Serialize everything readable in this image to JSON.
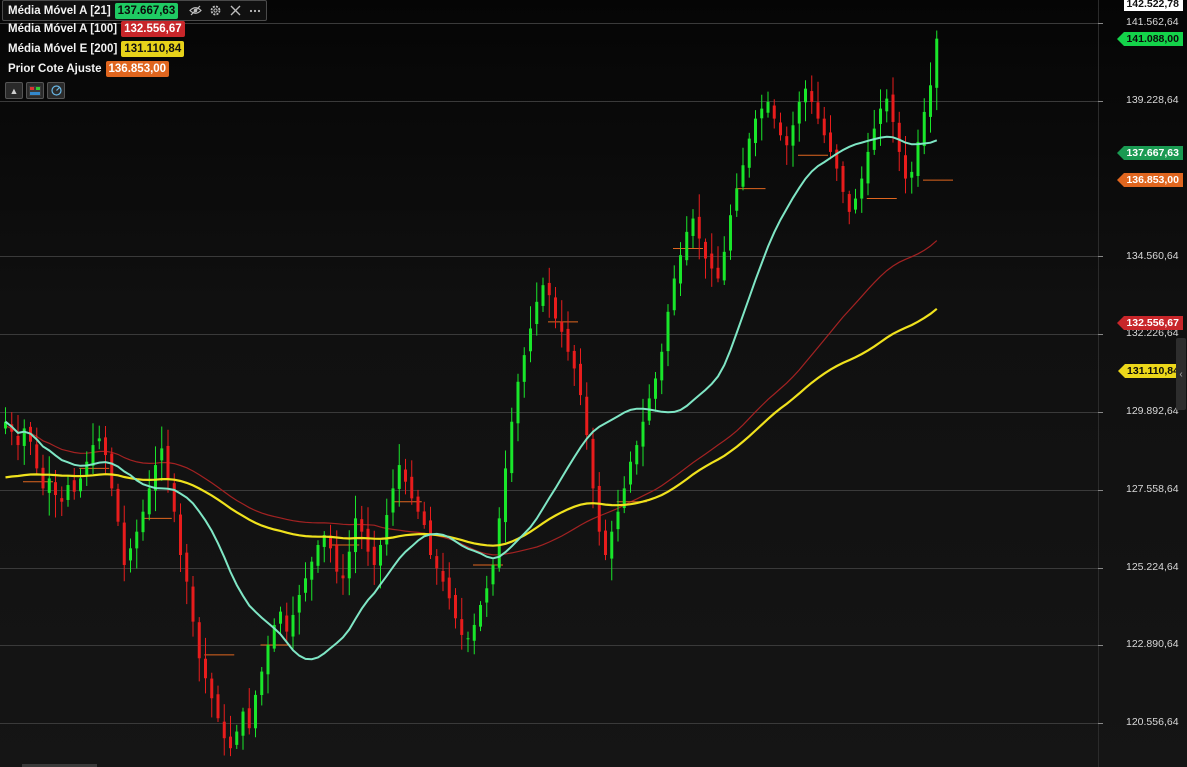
{
  "legend": [
    {
      "label": "Média Móvel A [21]",
      "value": "137.667,63",
      "color": "#1fca63"
    },
    {
      "label": "Média Móvel A [100]",
      "value": "132.556,67",
      "color": "#d42a2a"
    },
    {
      "label": "Média Móvel E [200]",
      "value": "131.110,84",
      "color": "#e7d21a"
    },
    {
      "label": "Prior Cote Ajuste",
      "value": "136.853,00",
      "color": "#e0661f"
    }
  ],
  "legend_icons": [
    "eye-off-icon",
    "gear-icon",
    "close-icon",
    "more-icon"
  ],
  "toolbar_icons": [
    "collapse-up-icon",
    "indicators-icon",
    "speedometer-icon"
  ],
  "price_axis": {
    "top_value": "142.522,78",
    "labels": [
      "141.562,64",
      "139.228,64",
      "134.560,64",
      "132.226,64",
      "129.892,64",
      "127.558,64",
      "125.224,64",
      "122.890,64",
      "120.556,64"
    ]
  },
  "tags": [
    {
      "value": "141.088,00",
      "price": 141088,
      "bg": "#14d34a",
      "fg": "#0a0a0a"
    },
    {
      "value": "137.667,63",
      "price": 137667.63,
      "bg": "#1a9a52",
      "fg": "#ffffff"
    },
    {
      "value": "136.853,00",
      "price": 136853,
      "bg": "#e0661f",
      "fg": "#ffffff"
    },
    {
      "value": "132.556,67",
      "price": 132556.67,
      "bg": "#c8262a",
      "fg": "#ffffff"
    },
    {
      "value": "131.110,84",
      "price": 131110.84,
      "bg": "#ecd71a",
      "fg": "#0a0a0a"
    }
  ],
  "colors": {
    "up": "#19e62a",
    "down": "#e81c1c",
    "ma21": "#7fe6c5",
    "ma100": "#a32222",
    "ema200": "#f0e21d",
    "prior_cote": "#e0661f"
  },
  "chart_data": {
    "type": "candlestick",
    "ylim": [
      119500,
      142522.78
    ],
    "grid": true,
    "current_price": 141088,
    "closes": [
      129600,
      129300,
      128900,
      129400,
      129000,
      128200,
      127600,
      127900,
      127400,
      127200,
      127700,
      127500,
      127900,
      128400,
      128900,
      129100,
      128600,
      127600,
      126600,
      125300,
      125800,
      126300,
      126900,
      127600,
      128300,
      128800,
      127900,
      126900,
      125600,
      124800,
      123600,
      122500,
      121900,
      121300,
      120700,
      120100,
      119800,
      120300,
      120900,
      120400,
      121400,
      122100,
      122900,
      123500,
      123900,
      123300,
      123800,
      124400,
      124900,
      125400,
      125900,
      126200,
      125800,
      125100,
      124900,
      125700,
      126700,
      126300,
      125700,
      125300,
      125900,
      126800,
      127600,
      128300,
      127800,
      127300,
      126900,
      126500,
      125600,
      125200,
      124800,
      124300,
      123700,
      123200,
      123100,
      123500,
      124100,
      124600,
      125300,
      126700,
      128200,
      129600,
      130800,
      131600,
      132400,
      133200,
      133700,
      133400,
      132700,
      132300,
      131700,
      131200,
      130400,
      129200,
      127600,
      126300,
      125600,
      126300,
      126900,
      127600,
      128400,
      128900,
      129600,
      130300,
      130900,
      131700,
      132900,
      133900,
      134600,
      135300,
      135700,
      135100,
      134500,
      134200,
      133900,
      134700,
      135800,
      136600,
      137300,
      138100,
      138700,
      139000,
      139200,
      138700,
      138200,
      137900,
      138500,
      139200,
      139600,
      139200,
      138700,
      138200,
      137700,
      137200,
      136500,
      135900,
      136300,
      136900,
      137700,
      138400,
      139000,
      139300,
      138600,
      137700,
      136900,
      137100,
      138000,
      138900,
      139700,
      141100
    ],
    "prior_cote_ticks": [
      {
        "i": 4,
        "price": 127800
      },
      {
        "i": 13,
        "price": 128200
      },
      {
        "i": 23,
        "price": 126700
      },
      {
        "i": 33,
        "price": 122600
      },
      {
        "i": 42,
        "price": 122900
      },
      {
        "i": 53,
        "price": 125900
      },
      {
        "i": 63,
        "price": 127200
      },
      {
        "i": 76,
        "price": 125300
      },
      {
        "i": 88,
        "price": 132600
      },
      {
        "i": 99,
        "price": 127200
      },
      {
        "i": 108,
        "price": 134800
      },
      {
        "i": 118,
        "price": 136600
      },
      {
        "i": 128,
        "price": 137600
      },
      {
        "i": 139,
        "price": 136300
      },
      {
        "i": 148,
        "price": 136853
      }
    ]
  }
}
